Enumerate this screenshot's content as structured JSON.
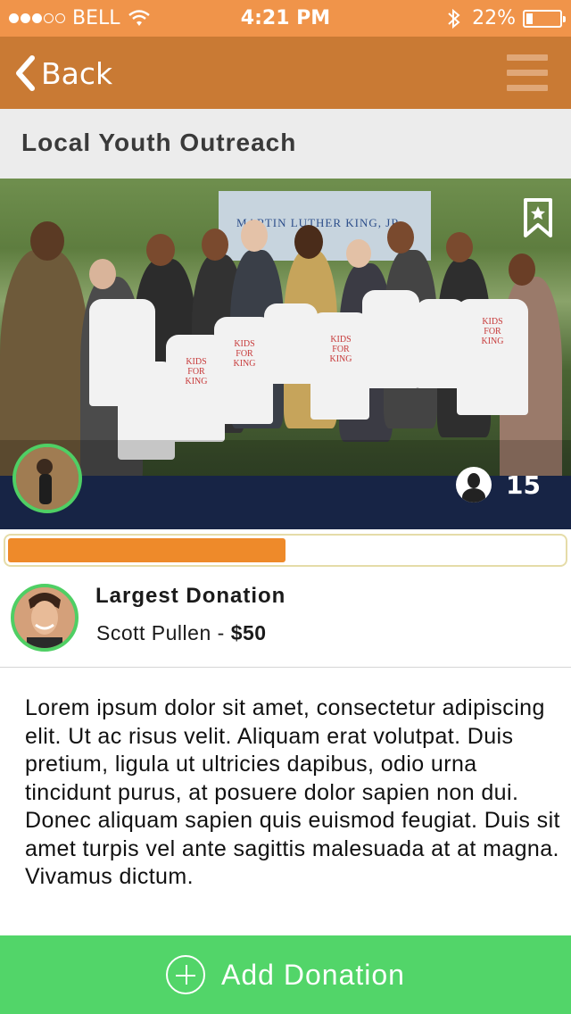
{
  "status_bar": {
    "carrier": "BELL",
    "signal_filled": 3,
    "signal_total": 5,
    "time": "4:21 PM",
    "battery": "22%",
    "battery_level": 0.22
  },
  "nav": {
    "back_label": "Back",
    "menu_icon": "hamburger-menu-icon"
  },
  "page": {
    "title": "Local Youth Outreach"
  },
  "hero": {
    "banner_text": "MARTIN LUTHER KING, JR.",
    "shirt_text": "KIDS FOR KING",
    "participant_count": "15",
    "bookmark_icon": "bookmark-star-icon"
  },
  "progress": {
    "fraction": 0.5
  },
  "largest_donation": {
    "label": "Largest Donation",
    "donor": "Scott Pullen",
    "separator": " - ",
    "amount": "$50"
  },
  "description": "Lorem ipsum dolor sit amet, consectetur adipiscing elit. Ut ac risus velit. Aliquam erat volutpat. Duis pretium, ligula ut ultricies dapibus, odio urna tincidunt purus, at posuere dolor sapien non dui. Donec aliquam sapien quis euismod feugiat. Duis sit amet turpis vel ante sagittis malesuada at at magna. Vivamus dictum.",
  "actions": {
    "add_donation_label": "Add Donation"
  },
  "colors": {
    "status_bar": "#f0944a",
    "nav_bar": "#c97a34",
    "accent_green": "#52d569",
    "progress_orange": "#ee8a2a"
  }
}
